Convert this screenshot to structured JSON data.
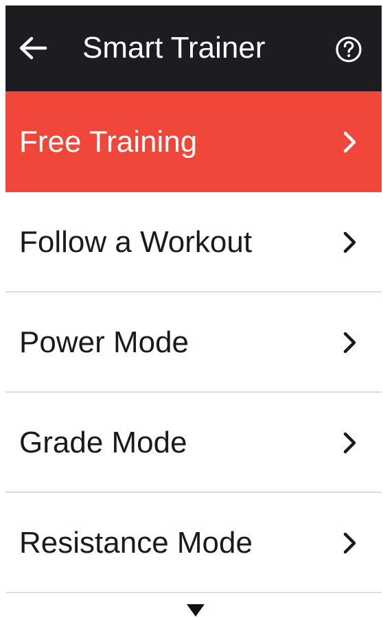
{
  "header": {
    "title": "Smart Trainer",
    "back_icon": "arrow-left-icon",
    "help_icon": "question-circle-icon"
  },
  "menu": {
    "items": [
      {
        "label": "Free Training",
        "active": true
      },
      {
        "label": "Follow a Workout",
        "active": false
      },
      {
        "label": "Power Mode",
        "active": false
      },
      {
        "label": "Grade Mode",
        "active": false
      },
      {
        "label": "Resistance Mode",
        "active": false
      }
    ],
    "chevron_icon": "chevron-right-icon",
    "more_icon": "triangle-down-icon"
  },
  "colors": {
    "header_bg": "#1d1c21",
    "active_bg": "#f0473a",
    "text": "#1a1a1a",
    "divider": "#dddddd"
  }
}
